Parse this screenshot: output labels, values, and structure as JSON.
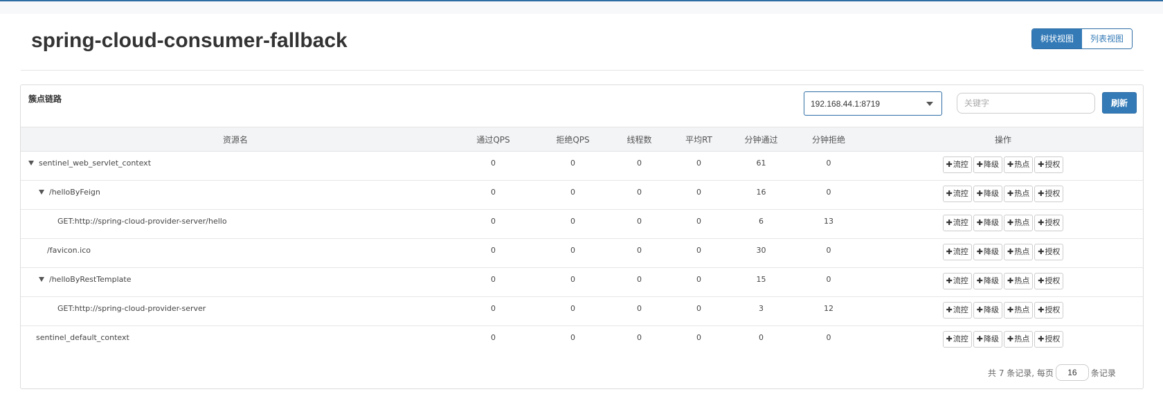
{
  "page": {
    "title": "spring-cloud-consumer-fallback"
  },
  "view_toggle": {
    "tree": "树状视图",
    "list": "列表视图"
  },
  "panel": {
    "title": "簇点链路",
    "machine": "192.168.44.1:8719",
    "search_placeholder": "关键字",
    "refresh": "刷新"
  },
  "table": {
    "headers": [
      "资源名",
      "通过QPS",
      "拒绝QPS",
      "线程数",
      "平均RT",
      "分钟通过",
      "分钟拒绝",
      "操作"
    ],
    "op_labels": [
      "流控",
      "降级",
      "热点",
      "授权"
    ],
    "rows": [
      {
        "name": "sentinel_web_servlet_context",
        "level": 0,
        "expandable": true,
        "values": [
          "0",
          "0",
          "0",
          "0",
          "61",
          "0"
        ]
      },
      {
        "name": "/helloByFeign",
        "level": 1,
        "expandable": true,
        "values": [
          "0",
          "0",
          "0",
          "0",
          "16",
          "0"
        ]
      },
      {
        "name": "GET:http://spring-cloud-provider-server/hello",
        "level": 2,
        "expandable": false,
        "values": [
          "0",
          "0",
          "0",
          "0",
          "6",
          "13"
        ]
      },
      {
        "name": "/favicon.ico",
        "level": 1,
        "expandable": false,
        "values": [
          "0",
          "0",
          "0",
          "0",
          "30",
          "0"
        ]
      },
      {
        "name": "/helloByRestTemplate",
        "level": 1,
        "expandable": true,
        "values": [
          "0",
          "0",
          "0",
          "0",
          "15",
          "0"
        ]
      },
      {
        "name": "GET:http://spring-cloud-provider-server",
        "level": 2,
        "expandable": false,
        "values": [
          "0",
          "0",
          "0",
          "0",
          "3",
          "12"
        ]
      },
      {
        "name": "sentinel_default_context",
        "level": 0,
        "expandable": false,
        "values": [
          "0",
          "0",
          "0",
          "0",
          "0",
          "0"
        ]
      }
    ]
  },
  "pagination": {
    "prefix": "共 7 条记录, 每页",
    "page_size": "16",
    "suffix": "条记录"
  }
}
